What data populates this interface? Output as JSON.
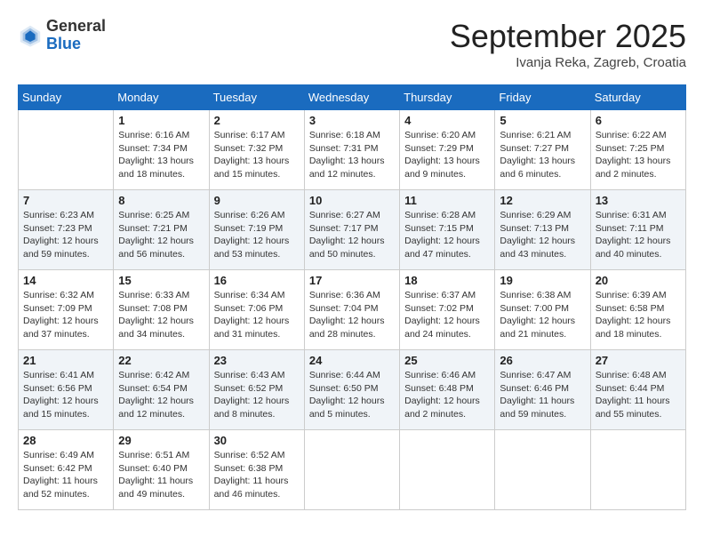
{
  "header": {
    "logo_general": "General",
    "logo_blue": "Blue",
    "month_title": "September 2025",
    "location": "Ivanja Reka, Zagreb, Croatia"
  },
  "weekdays": [
    "Sunday",
    "Monday",
    "Tuesday",
    "Wednesday",
    "Thursday",
    "Friday",
    "Saturday"
  ],
  "weeks": [
    [
      {
        "day": "",
        "info": ""
      },
      {
        "day": "1",
        "info": "Sunrise: 6:16 AM\nSunset: 7:34 PM\nDaylight: 13 hours\nand 18 minutes."
      },
      {
        "day": "2",
        "info": "Sunrise: 6:17 AM\nSunset: 7:32 PM\nDaylight: 13 hours\nand 15 minutes."
      },
      {
        "day": "3",
        "info": "Sunrise: 6:18 AM\nSunset: 7:31 PM\nDaylight: 13 hours\nand 12 minutes."
      },
      {
        "day": "4",
        "info": "Sunrise: 6:20 AM\nSunset: 7:29 PM\nDaylight: 13 hours\nand 9 minutes."
      },
      {
        "day": "5",
        "info": "Sunrise: 6:21 AM\nSunset: 7:27 PM\nDaylight: 13 hours\nand 6 minutes."
      },
      {
        "day": "6",
        "info": "Sunrise: 6:22 AM\nSunset: 7:25 PM\nDaylight: 13 hours\nand 2 minutes."
      }
    ],
    [
      {
        "day": "7",
        "info": "Sunrise: 6:23 AM\nSunset: 7:23 PM\nDaylight: 12 hours\nand 59 minutes."
      },
      {
        "day": "8",
        "info": "Sunrise: 6:25 AM\nSunset: 7:21 PM\nDaylight: 12 hours\nand 56 minutes."
      },
      {
        "day": "9",
        "info": "Sunrise: 6:26 AM\nSunset: 7:19 PM\nDaylight: 12 hours\nand 53 minutes."
      },
      {
        "day": "10",
        "info": "Sunrise: 6:27 AM\nSunset: 7:17 PM\nDaylight: 12 hours\nand 50 minutes."
      },
      {
        "day": "11",
        "info": "Sunrise: 6:28 AM\nSunset: 7:15 PM\nDaylight: 12 hours\nand 47 minutes."
      },
      {
        "day": "12",
        "info": "Sunrise: 6:29 AM\nSunset: 7:13 PM\nDaylight: 12 hours\nand 43 minutes."
      },
      {
        "day": "13",
        "info": "Sunrise: 6:31 AM\nSunset: 7:11 PM\nDaylight: 12 hours\nand 40 minutes."
      }
    ],
    [
      {
        "day": "14",
        "info": "Sunrise: 6:32 AM\nSunset: 7:09 PM\nDaylight: 12 hours\nand 37 minutes."
      },
      {
        "day": "15",
        "info": "Sunrise: 6:33 AM\nSunset: 7:08 PM\nDaylight: 12 hours\nand 34 minutes."
      },
      {
        "day": "16",
        "info": "Sunrise: 6:34 AM\nSunset: 7:06 PM\nDaylight: 12 hours\nand 31 minutes."
      },
      {
        "day": "17",
        "info": "Sunrise: 6:36 AM\nSunset: 7:04 PM\nDaylight: 12 hours\nand 28 minutes."
      },
      {
        "day": "18",
        "info": "Sunrise: 6:37 AM\nSunset: 7:02 PM\nDaylight: 12 hours\nand 24 minutes."
      },
      {
        "day": "19",
        "info": "Sunrise: 6:38 AM\nSunset: 7:00 PM\nDaylight: 12 hours\nand 21 minutes."
      },
      {
        "day": "20",
        "info": "Sunrise: 6:39 AM\nSunset: 6:58 PM\nDaylight: 12 hours\nand 18 minutes."
      }
    ],
    [
      {
        "day": "21",
        "info": "Sunrise: 6:41 AM\nSunset: 6:56 PM\nDaylight: 12 hours\nand 15 minutes."
      },
      {
        "day": "22",
        "info": "Sunrise: 6:42 AM\nSunset: 6:54 PM\nDaylight: 12 hours\nand 12 minutes."
      },
      {
        "day": "23",
        "info": "Sunrise: 6:43 AM\nSunset: 6:52 PM\nDaylight: 12 hours\nand 8 minutes."
      },
      {
        "day": "24",
        "info": "Sunrise: 6:44 AM\nSunset: 6:50 PM\nDaylight: 12 hours\nand 5 minutes."
      },
      {
        "day": "25",
        "info": "Sunrise: 6:46 AM\nSunset: 6:48 PM\nDaylight: 12 hours\nand 2 minutes."
      },
      {
        "day": "26",
        "info": "Sunrise: 6:47 AM\nSunset: 6:46 PM\nDaylight: 11 hours\nand 59 minutes."
      },
      {
        "day": "27",
        "info": "Sunrise: 6:48 AM\nSunset: 6:44 PM\nDaylight: 11 hours\nand 55 minutes."
      }
    ],
    [
      {
        "day": "28",
        "info": "Sunrise: 6:49 AM\nSunset: 6:42 PM\nDaylight: 11 hours\nand 52 minutes."
      },
      {
        "day": "29",
        "info": "Sunrise: 6:51 AM\nSunset: 6:40 PM\nDaylight: 11 hours\nand 49 minutes."
      },
      {
        "day": "30",
        "info": "Sunrise: 6:52 AM\nSunset: 6:38 PM\nDaylight: 11 hours\nand 46 minutes."
      },
      {
        "day": "",
        "info": ""
      },
      {
        "day": "",
        "info": ""
      },
      {
        "day": "",
        "info": ""
      },
      {
        "day": "",
        "info": ""
      }
    ]
  ]
}
